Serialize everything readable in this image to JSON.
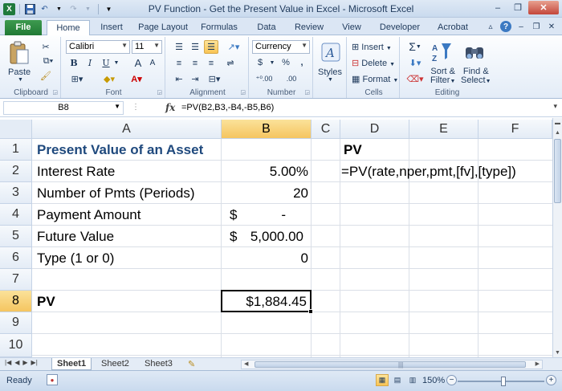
{
  "window": {
    "title": "PV Function - Get the Present Value in Excel  -  Microsoft Excel",
    "qat": {
      "logo": "X",
      "save_icon": "save-icon",
      "undo_icon": "undo-icon",
      "redo_icon": "redo-icon"
    },
    "buttons": {
      "minimize": "–",
      "restore": "❐",
      "close": "✕"
    }
  },
  "ribbon_tabs": [
    {
      "label": "File"
    },
    {
      "label": "Home"
    },
    {
      "label": "Insert"
    },
    {
      "label": "Page Layout"
    },
    {
      "label": "Formulas"
    },
    {
      "label": "Data"
    },
    {
      "label": "Review"
    },
    {
      "label": "View"
    },
    {
      "label": "Developer"
    },
    {
      "label": "Acrobat"
    }
  ],
  "ribbon": {
    "clipboard": {
      "label": "Clipboard",
      "paste": "Paste"
    },
    "font": {
      "label": "Font",
      "name": "Calibri",
      "size": "11",
      "bold": "B",
      "italic": "I",
      "underline": "U",
      "grow": "A",
      "shrink": "A"
    },
    "alignment": {
      "label": "Alignment"
    },
    "number": {
      "label": "Number",
      "format": "Currency",
      "currency": "$",
      "percent": "%",
      "comma": ",",
      "inc_dec": "⁺⁰.00",
      "dec_dec": ".00"
    },
    "styles": {
      "label": "Styles"
    },
    "cells": {
      "label": "Cells",
      "insert": "Insert",
      "delete": "Delete",
      "format": "Format"
    },
    "editing": {
      "label": "Editing",
      "sort": "Sort &",
      "sort2": "Filter",
      "find": "Find &",
      "find2": "Select",
      "sigma": "Σ"
    }
  },
  "formula_bar": {
    "name_box": "B8",
    "fx": "fx",
    "formula": "=PV(B2,B3,-B4,-B5,B6)"
  },
  "columns": [
    "A",
    "B",
    "C",
    "D",
    "E",
    "F"
  ],
  "rows": [
    "1",
    "2",
    "3",
    "4",
    "5",
    "6",
    "7",
    "8",
    "9",
    "10"
  ],
  "cells": {
    "A1": "Present Value of an Asset",
    "A2": "Interest Rate",
    "A3": "Number of Pmts (Periods)",
    "A4": "Payment Amount",
    "A5": "Future Value",
    "A6": "Type (1 or 0)",
    "A8": "PV",
    "B2": "5.00%",
    "B3": "20",
    "B4_sym": "$",
    "B4_val": "-",
    "B5_sym": "$",
    "B5_val": "5,000.00",
    "B6": "0",
    "B8": "$1,884.45",
    "D1": "PV",
    "D2": "=PV(rate,nper,pmt,[fv],[type])"
  },
  "sheets": [
    {
      "label": "Sheet1"
    },
    {
      "label": "Sheet2"
    },
    {
      "label": "Sheet3"
    }
  ],
  "status": {
    "ready": "Ready",
    "zoom": "150%",
    "minus": "−",
    "plus": "+"
  },
  "colors": {
    "title_blue": "#1f497d",
    "selected_header": "#f5c560",
    "file_tab": "#217a35"
  }
}
